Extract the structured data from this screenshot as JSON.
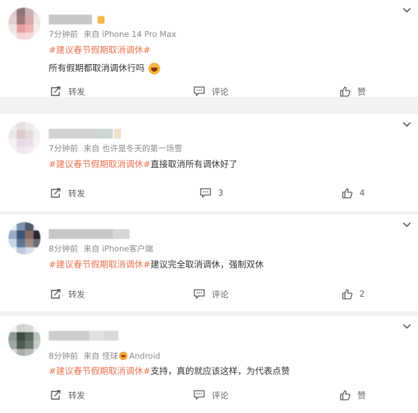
{
  "colors": {
    "topic": "#eb7350",
    "meta": "#8a8a8a",
    "text": "#333333",
    "action": "#636363",
    "divider": "#f2f2f2"
  },
  "icons": {
    "menu": "chevron-down-icon",
    "repost": "repost-icon",
    "comment": "comment-icon",
    "like": "thumbs-up-icon",
    "emoji_post1": "laughing-crying-emoji-icon",
    "badge_post4": "angry-face-emoji-icon"
  },
  "posts": [
    {
      "time": "7分钟前",
      "source": "来自 iPhone 14 Pro Max",
      "topic": "#建议春节假期取消调休#",
      "text": "",
      "text_line2": "所有假期都取消调休行吗",
      "repost_label": "转发",
      "comment_label": "评论",
      "comment_count": "",
      "like_label": "赞",
      "like_count": ""
    },
    {
      "time": "7分钟前",
      "source": "来自 也许是冬天的第一场雪",
      "topic": "#建议春节假期取消调休#",
      "text": "直接取消所有调休好了",
      "repost_label": "转发",
      "comment_label": "",
      "comment_count": "3",
      "like_label": "",
      "like_count": "4"
    },
    {
      "time": "8分钟前",
      "source": "来自 iPhone客户端",
      "topic": "#建议春节假期取消调休#",
      "text": "建议完全取消调休，强制双休",
      "repost_label": "转发",
      "comment_label": "评论",
      "comment_count": "",
      "like_label": "",
      "like_count": "2"
    },
    {
      "time": "8分钟前",
      "source_prefix": "来自 怪球",
      "source_suffix": "Android",
      "topic": "#建议春节假期取消调休#",
      "text": "支持，真的就应该这样，为代表点赞",
      "repost_label": "转发",
      "comment_label": "评论",
      "comment_count": "",
      "like_label": "赞",
      "like_count": ""
    }
  ]
}
